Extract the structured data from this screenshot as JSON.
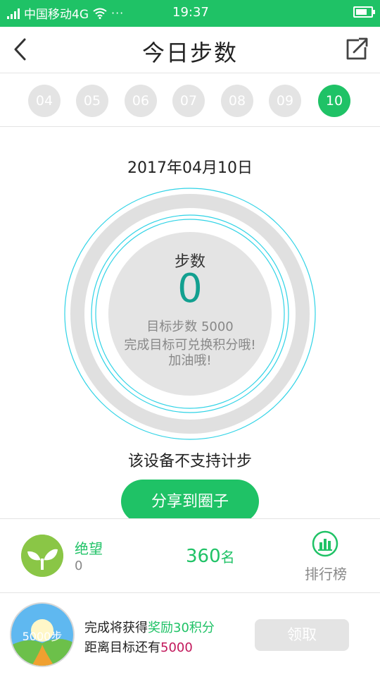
{
  "status_bar": {
    "carrier": "中国移动4G",
    "more": "···",
    "time": "19:37"
  },
  "nav": {
    "title": "今日步数"
  },
  "dates": {
    "days": [
      "04",
      "05",
      "06",
      "07",
      "08",
      "09",
      "10"
    ],
    "selected": "10"
  },
  "summary": {
    "date": "2017年04月10日",
    "label": "步数",
    "value": "0",
    "goal": "目标步数 5000",
    "hint1": "完成目标可兑换积分哦!",
    "hint2": "加油哦!",
    "unsupported": "该设备不支持计步",
    "share_button": "分享到圈子"
  },
  "rank": {
    "user_name": "绝望",
    "user_steps": "0",
    "rank_value": "360",
    "rank_unit": "名",
    "leaderboard_label": "排行榜"
  },
  "reward": {
    "badge_text": "5000步",
    "line1_prefix": "完成将获得",
    "line1_highlight": "奖励30积分",
    "line2_prefix": "距离目标还有",
    "line2_highlight": "5000",
    "claim_button": "领取"
  },
  "colors": {
    "accent": "#1fc266",
    "ring_text": "#12a090",
    "highlight_pink": "#c2185b",
    "inactive": "#e4e4e4"
  }
}
